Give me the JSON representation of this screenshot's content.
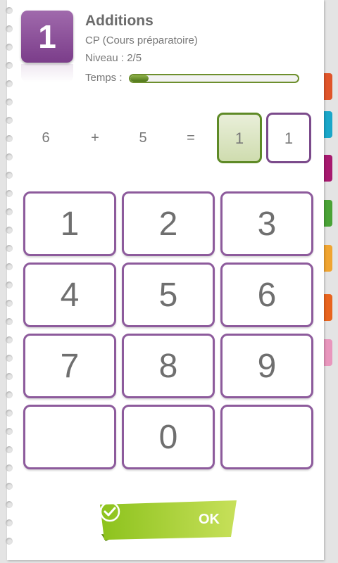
{
  "exercise": {
    "number": "1",
    "title": "Additions",
    "grade": "CP (Cours préparatoire)",
    "level": "Niveau : 2/5",
    "time_label": "Temps :",
    "time_progress": 0.11
  },
  "equation": {
    "operand1": "6",
    "operator": "+",
    "operand2": "5",
    "equals": "=",
    "answer_digits": [
      "1",
      "1"
    ]
  },
  "keypad": {
    "keys": [
      "1",
      "2",
      "3",
      "4",
      "5",
      "6",
      "7",
      "8",
      "9",
      "",
      "0",
      ""
    ]
  },
  "ok_button": {
    "label": "OK"
  },
  "tab_colors": [
    "#e0552a",
    "#1aa7c9",
    "#a7196f",
    "#4aa336",
    "#f0a531",
    "#e8641e",
    "#e896bd"
  ]
}
